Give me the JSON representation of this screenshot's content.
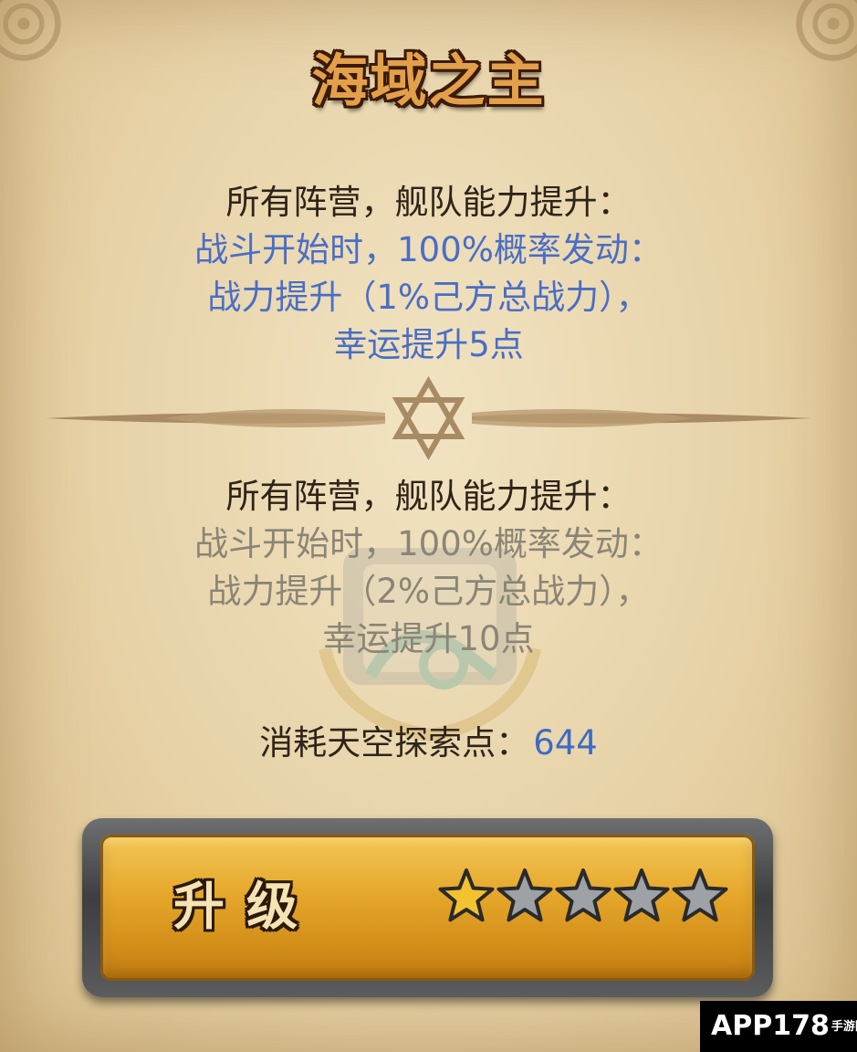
{
  "title": "海域之主",
  "current_level": {
    "heading": "所有阵营，舰队能力提升：",
    "lines": [
      "战斗开始时，100%概率发动：",
      "战力提升（1%己方总战力），",
      "幸运提升5点"
    ]
  },
  "next_level": {
    "heading": "所有阵营，舰队能力提升：",
    "lines": [
      "战斗开始时，100%概率发动：",
      "战力提升（2%己方总战力），",
      "幸运提升10点"
    ]
  },
  "cost": {
    "label": "消耗天空探索点：",
    "value": "644"
  },
  "upgrade": {
    "label": "升级",
    "stars_filled": 1,
    "stars_total": 5
  },
  "watermark": {
    "main": "APP178",
    "sub": "手游网.com"
  },
  "colors": {
    "effect_active": "#4a6ec6",
    "effect_inactive": "#8a8576",
    "cost_value": "#3d6bc4",
    "title_fill": "#e3a04a",
    "star_filled": "#f2c230",
    "star_empty": "#9ea2a6"
  },
  "icons": {
    "divider": "hexagram-divider-icon",
    "emblem": "wave-emblem-icon",
    "star": "star-icon"
  }
}
